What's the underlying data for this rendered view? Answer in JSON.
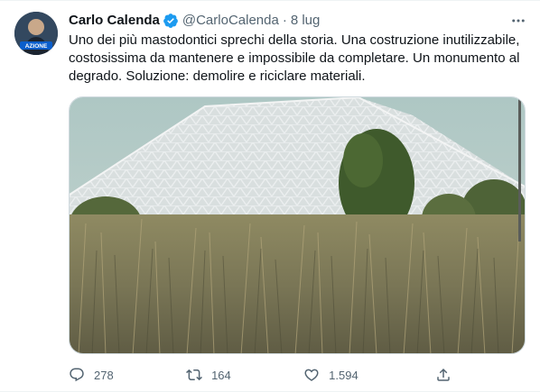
{
  "tweet": {
    "author_name": "Carlo Calenda",
    "handle": "@CarloCalenda",
    "separator": "·",
    "date": "8 lug",
    "avatar_badge": "AZIONE",
    "text": "Uno dei più mastodontici sprechi della storia. Una costruzione inutilizzabile, costosissima da mantenere e impossibile da completare. Un monumento al degrado. Soluzione: demolire e riciclare materiali.",
    "stats": {
      "replies": "278",
      "retweets": "164",
      "likes": "1.594"
    }
  },
  "icons": {
    "verified": "verified-badge-icon",
    "more": "more-options-icon",
    "reply": "reply-icon",
    "retweet": "retweet-icon",
    "like": "heart-icon",
    "share": "share-icon"
  },
  "colors": {
    "verified": "#1d9bf0",
    "secondary_text": "#536471",
    "primary_text": "#0f1419"
  }
}
